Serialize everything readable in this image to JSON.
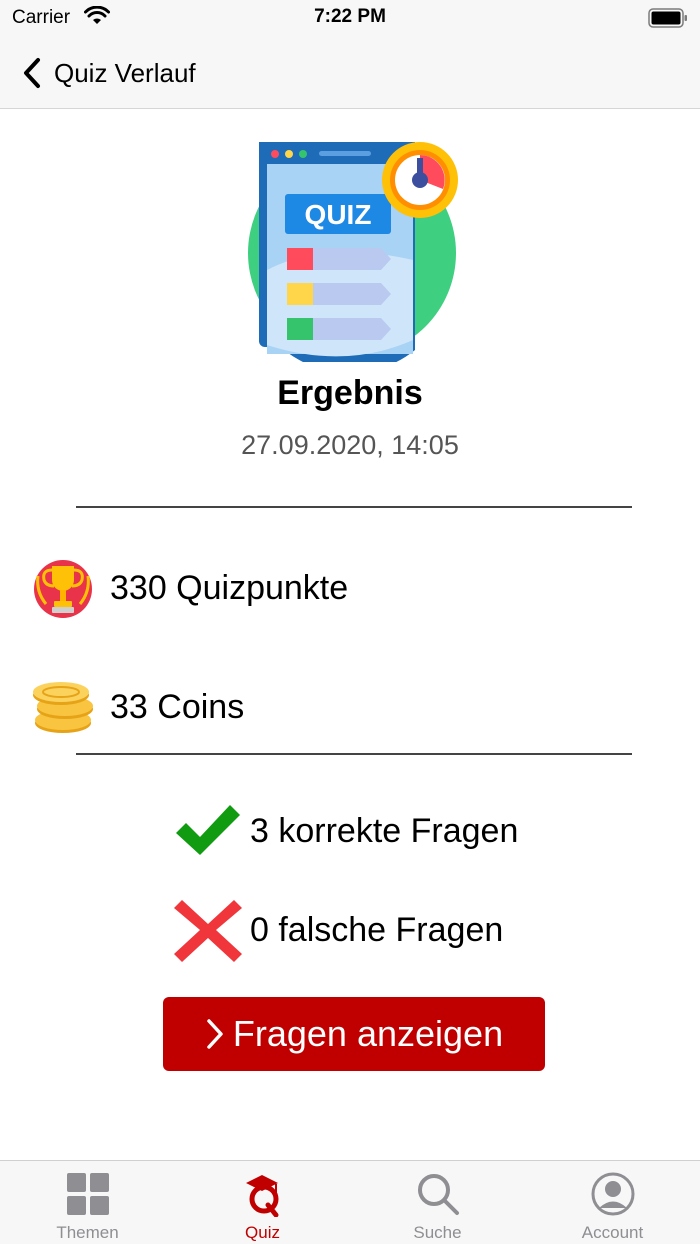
{
  "status_bar": {
    "carrier": "Carrier",
    "time": "7:22 PM"
  },
  "nav": {
    "back_label": "Quiz Verlauf"
  },
  "hero": {
    "badge_text": "QUIZ"
  },
  "result": {
    "title": "Ergebnis",
    "date": "27.09.2020, 14:05"
  },
  "stats": {
    "points_label": "330 Quizpunkte",
    "coins_label": "33 Coins"
  },
  "answers": {
    "correct_label": "3 korrekte Fragen",
    "wrong_label": "0 falsche Fragen"
  },
  "actions": {
    "show_questions_label": "Fragen anzeigen"
  },
  "tabs": [
    {
      "label": "Themen",
      "icon": "grid-icon",
      "active": false
    },
    {
      "label": "Quiz",
      "icon": "quiz-logo-icon",
      "active": true
    },
    {
      "label": "Suche",
      "icon": "search-icon",
      "active": false
    },
    {
      "label": "Account",
      "icon": "account-icon",
      "active": false
    }
  ],
  "colors": {
    "accent": "#c00000",
    "tab_inactive": "#8e8e93",
    "correct": "#119b11",
    "wrong": "#f0353b"
  }
}
